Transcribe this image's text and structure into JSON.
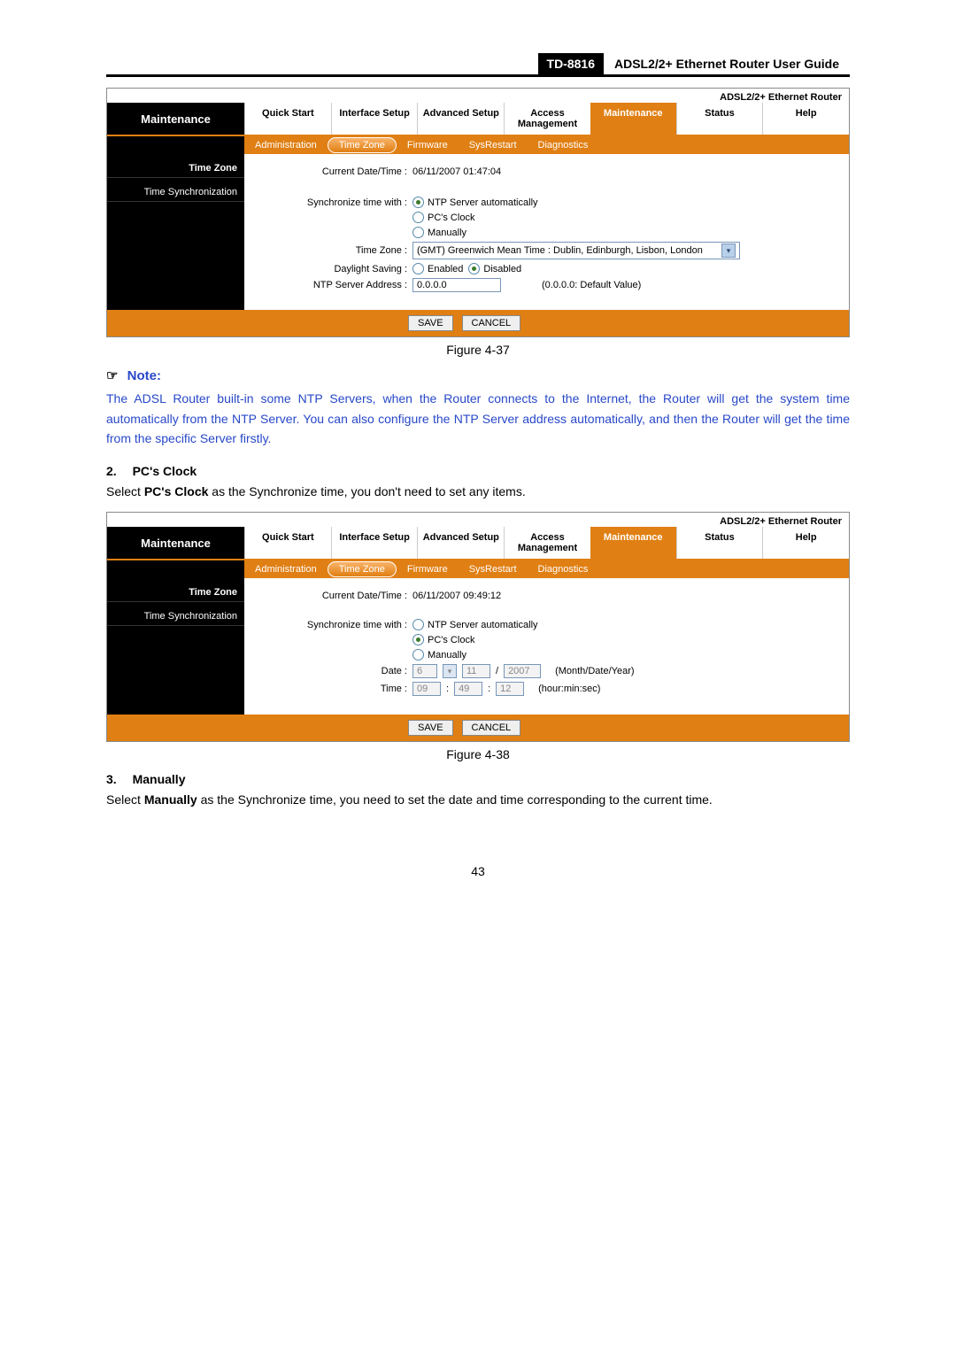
{
  "header": {
    "model": "TD-8816",
    "guide_title": "ADSL2/2+ Ethernet Router User Guide"
  },
  "router_brand": "ADSL2/2+ Ethernet Router",
  "main_tabs": {
    "side": "Maintenance",
    "items": [
      "Quick Start",
      "Interface Setup",
      "Advanced Setup",
      "Access Management",
      "Maintenance",
      "Status",
      "Help"
    ],
    "active_index": 4
  },
  "sub_tabs": {
    "items": [
      "Administration",
      "Time Zone",
      "Firmware",
      "SysRestart",
      "Diagnostics"
    ],
    "active_index": 1
  },
  "left_menu": {
    "items": [
      "Time Zone",
      "Time Synchronization"
    ]
  },
  "fig37": {
    "current_label": "Current Date/Time :",
    "current_value": "06/11/2007 01:47:04",
    "sync_label": "Synchronize time with :",
    "opt_ntp": "NTP Server automatically",
    "opt_pc": "PC's Clock",
    "opt_manual": "Manually",
    "tz_label": "Time Zone :",
    "tz_value": "(GMT) Greenwich Mean Time : Dublin, Edinburgh, Lisbon, London",
    "dst_label": "Daylight Saving :",
    "dst_enabled": "Enabled",
    "dst_disabled": "Disabled",
    "ntp_label": "NTP Server Address :",
    "ntp_value": "0.0.0.0",
    "ntp_hint": "(0.0.0.0: Default Value)"
  },
  "fig38": {
    "current_label": "Current Date/Time :",
    "current_value": "06/11/2007 09:49:12",
    "sync_label": "Synchronize time with :",
    "opt_ntp": "NTP Server automatically",
    "opt_pc": "PC's Clock",
    "opt_manual": "Manually",
    "date_label": "Date :",
    "date_m": "6",
    "date_d": "11",
    "date_y": "2007",
    "date_hint": "(Month/Date/Year)",
    "time_label": "Time :",
    "time_h": "09",
    "time_m": "49",
    "time_s": "12",
    "time_hint": "(hour:min:sec)"
  },
  "buttons": {
    "save": "SAVE",
    "cancel": "CANCEL"
  },
  "captions": {
    "f37": "Figure 4-37",
    "f38": "Figure 4-38"
  },
  "note": {
    "header": "Note:",
    "icon": "☞",
    "body": "The ADSL Router built-in some NTP Servers, when the Router connects to the Internet, the Router will get the system time automatically from the NTP Server. You can also configure the NTP Server address automatically, and then the Router will get the time from the specific Server firstly."
  },
  "sections": {
    "s2_num": "2.",
    "s2_title": "PC's Clock",
    "s2_text_pre": "Select ",
    "s2_text_bold": "PC's Clock",
    "s2_text_post": " as the Synchronize time, you don't need to set any items.",
    "s3_num": "3.",
    "s3_title": "Manually",
    "s3_text_pre": "Select ",
    "s3_text_bold": "Manually",
    "s3_text_post": " as the Synchronize time, you need to set the date and time corresponding to the current time."
  },
  "page_number": "43"
}
